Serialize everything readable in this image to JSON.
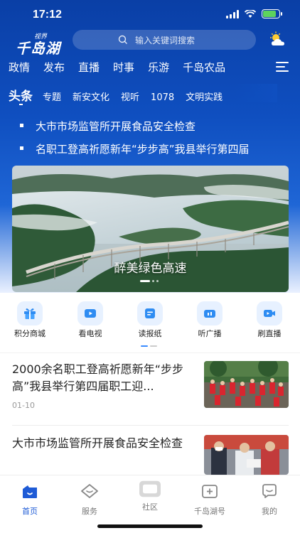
{
  "status_bar": {
    "time": "17:12"
  },
  "header": {
    "logo_small": "视界",
    "logo_main": "千岛湖",
    "search_placeholder": "输入关键词搜索"
  },
  "nav_primary": [
    "政情",
    "发布",
    "直播",
    "时事",
    "乐游",
    "千岛农品"
  ],
  "nav_secondary": {
    "active": "头条",
    "items": [
      "专题",
      "新安文化",
      "视听",
      "1078",
      "文明实践"
    ]
  },
  "ticker": [
    "大市市场监管所开展食品安全检查",
    "名职工登高祈愿新年“步步高”我县举行第四届"
  ],
  "banner": {
    "caption": "醉美绿色高速"
  },
  "quick_links": [
    {
      "label": "积分商城",
      "icon": "gift-icon"
    },
    {
      "label": "看电视",
      "icon": "tv-play-icon"
    },
    {
      "label": "读报纸",
      "icon": "newspaper-icon"
    },
    {
      "label": "听广播",
      "icon": "radio-icon"
    },
    {
      "label": "刷直播",
      "icon": "live-camera-icon"
    }
  ],
  "news": [
    {
      "title": "2000余名职工登高祈愿新年“步步高”我县举行第四届职工迎...",
      "date": "01-10"
    },
    {
      "title": "大市市场监管所开展食品安全检查",
      "date": ""
    }
  ],
  "tabbar": [
    {
      "label": "首页",
      "icon": "home-icon",
      "active": true
    },
    {
      "label": "服务",
      "icon": "service-icon",
      "active": false
    },
    {
      "label": "社区",
      "icon": "community-icon",
      "active": false
    },
    {
      "label": "千岛湖号",
      "icon": "account-icon",
      "active": false
    },
    {
      "label": "我的",
      "icon": "profile-icon",
      "active": false
    }
  ],
  "colors": {
    "header_blue": "#0f4fc0",
    "accent_blue": "#1e5bd6",
    "quick_icon_bg": "#e7f1ff"
  }
}
